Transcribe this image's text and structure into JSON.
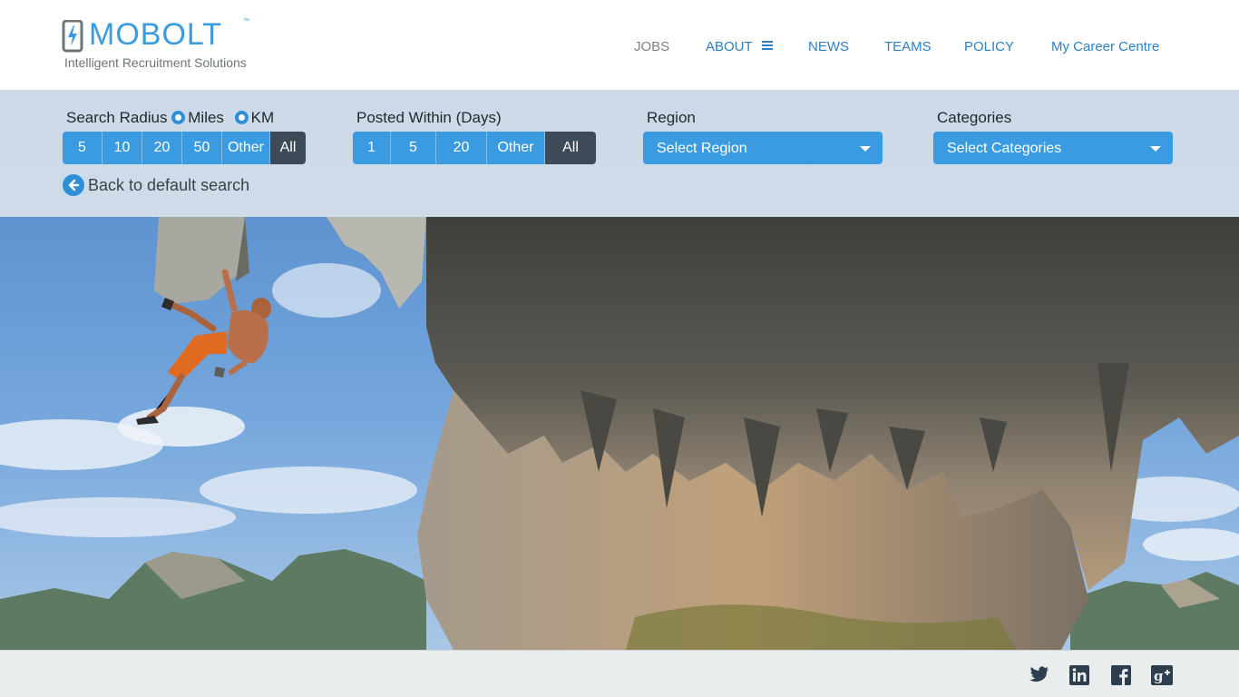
{
  "brand": {
    "name": "MOBOLT",
    "trademark": "™",
    "tagline": "Intelligent Recruitment Solutions",
    "color": "#3a9be0"
  },
  "nav": {
    "items": [
      {
        "label": "JOBS",
        "active": true
      },
      {
        "label": "ABOUT",
        "has_menu_icon": true
      },
      {
        "label": "NEWS"
      },
      {
        "label": "TEAMS"
      },
      {
        "label": "POLICY"
      },
      {
        "label": "My Career Centre"
      }
    ]
  },
  "filters": {
    "radius": {
      "label": "Search Radius",
      "units": [
        {
          "label": "Miles",
          "checked": true
        },
        {
          "label": "KM",
          "checked": false
        }
      ],
      "options": [
        "5",
        "10",
        "20",
        "50",
        "Other",
        "All"
      ],
      "selected": "All"
    },
    "posted": {
      "label": "Posted Within (Days)",
      "options": [
        "1",
        "5",
        "20",
        "Other",
        "All"
      ],
      "selected": "All"
    },
    "region": {
      "label": "Region",
      "value": "Select Region"
    },
    "categories": {
      "label": "Categories",
      "value": "Select Categories"
    },
    "back_label": "Back to default search"
  },
  "footer": {
    "social": [
      "twitter-icon",
      "linkedin-icon",
      "facebook-icon",
      "google-plus-icon"
    ]
  },
  "colors": {
    "accent": "#3a9be0",
    "selected": "#3d4a57",
    "nav": "#2f7fc1"
  }
}
